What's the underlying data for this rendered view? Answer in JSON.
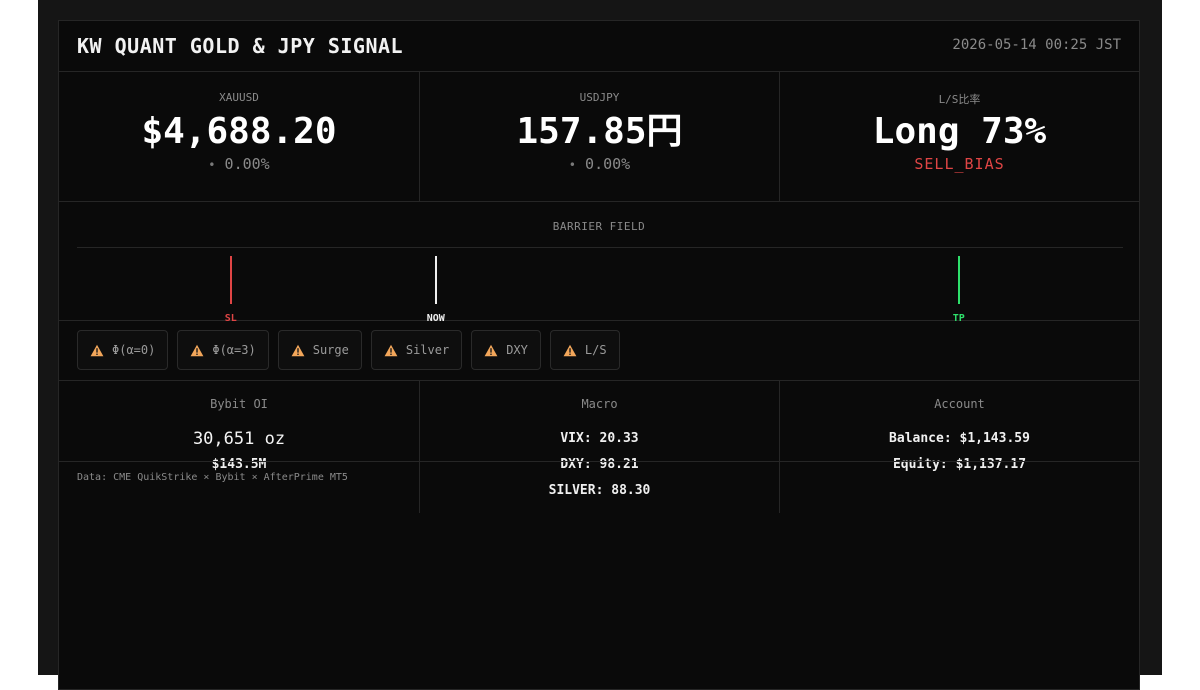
{
  "header": {
    "title": "KW QUANT GOLD & JPY SIGNAL",
    "timestamp": "2026-05-14 00:25 JST"
  },
  "tiles": [
    {
      "label": "XAUUSD",
      "value": "$4,688.20",
      "dot": "•",
      "change": "0.00%"
    },
    {
      "label": "USDJPY",
      "value": "157.85円",
      "dot": "•",
      "change": "0.00%"
    },
    {
      "label": "L/S比率",
      "value": "Long 73%",
      "sub": "SELL_BIAS"
    }
  ],
  "barrier": {
    "title": "BARRIER FIELD",
    "markers": [
      {
        "label": "SL",
        "position_pct": 14.7,
        "color": "#e04545"
      },
      {
        "label": "NOW",
        "position_pct": 34.3,
        "color": "#f0f0f0"
      },
      {
        "label": "TP",
        "position_pct": 84.3,
        "color": "#2ee06b"
      }
    ]
  },
  "alerts": [
    {
      "label": "Φ(α=0)",
      "icon": "warning-icon"
    },
    {
      "label": "Φ(α=3)",
      "icon": "warning-icon"
    },
    {
      "label": "Surge",
      "icon": "warning-icon"
    },
    {
      "label": "Silver",
      "icon": "warning-icon"
    },
    {
      "label": "DXY",
      "icon": "warning-icon"
    },
    {
      "label": "L/S",
      "icon": "warning-icon"
    }
  ],
  "stats": {
    "oi": {
      "title": "Bybit OI",
      "amount": "30,651 oz",
      "usd": "$143.5M"
    },
    "macro": {
      "title": "Macro",
      "vix": "VIX: 20.33",
      "dxy": "DXY: 98.21",
      "silver": "SILVER: 88.30"
    },
    "account": {
      "title": "Account",
      "balance": "Balance: $1,143.59",
      "equity": "Equity: $1,137.17"
    }
  },
  "footnote": "Data: CME QuikStrike × Bybit × AfterPrime MT5",
  "colors": {
    "background": "#0a0a0a",
    "sell": "#e04545",
    "tp": "#2ee06b",
    "warning": "#f2a65a"
  }
}
